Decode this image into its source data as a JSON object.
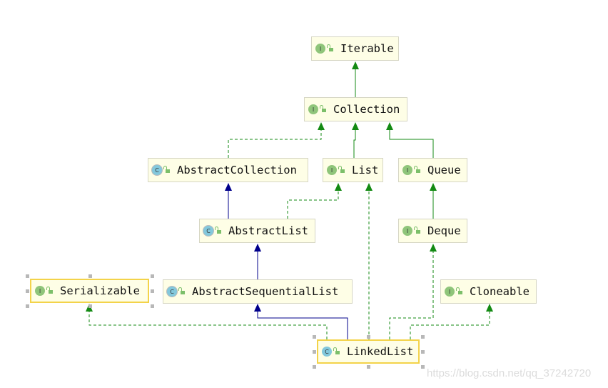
{
  "nodes": [
    {
      "id": "Iterable",
      "label": "Iterable",
      "kind": "interface",
      "badge": "I",
      "selected": false
    },
    {
      "id": "Collection",
      "label": "Collection",
      "kind": "interface",
      "badge": "I",
      "selected": false
    },
    {
      "id": "AbstractCollection",
      "label": "AbstractCollection",
      "kind": "abstract-class",
      "badge": "C",
      "selected": false
    },
    {
      "id": "List",
      "label": "List",
      "kind": "interface",
      "badge": "I",
      "selected": false
    },
    {
      "id": "Queue",
      "label": "Queue",
      "kind": "interface",
      "badge": "I",
      "selected": false
    },
    {
      "id": "AbstractList",
      "label": "AbstractList",
      "kind": "abstract-class",
      "badge": "C",
      "selected": false
    },
    {
      "id": "Deque",
      "label": "Deque",
      "kind": "interface",
      "badge": "I",
      "selected": false
    },
    {
      "id": "Serializable",
      "label": "Serializable",
      "kind": "interface",
      "badge": "I",
      "selected": true
    },
    {
      "id": "AbstractSequentialList",
      "label": "AbstractSequentialList",
      "kind": "abstract-class",
      "badge": "C",
      "selected": false
    },
    {
      "id": "Cloneable",
      "label": "Cloneable",
      "kind": "interface",
      "badge": "I",
      "selected": false
    },
    {
      "id": "LinkedList",
      "label": "LinkedList",
      "kind": "class",
      "badge": "C",
      "selected": true
    }
  ],
  "edges": [
    {
      "from": "Collection",
      "to": "Iterable",
      "type": "extends-interface"
    },
    {
      "from": "List",
      "to": "Collection",
      "type": "extends-interface"
    },
    {
      "from": "Queue",
      "to": "Collection",
      "type": "extends-interface"
    },
    {
      "from": "AbstractCollection",
      "to": "Collection",
      "type": "implements"
    },
    {
      "from": "AbstractList",
      "to": "AbstractCollection",
      "type": "extends-class"
    },
    {
      "from": "AbstractList",
      "to": "List",
      "type": "implements"
    },
    {
      "from": "Deque",
      "to": "Queue",
      "type": "extends-interface"
    },
    {
      "from": "AbstractSequentialList",
      "to": "AbstractList",
      "type": "extends-class"
    },
    {
      "from": "LinkedList",
      "to": "AbstractSequentialList",
      "type": "extends-class"
    },
    {
      "from": "LinkedList",
      "to": "Serializable",
      "type": "implements"
    },
    {
      "from": "LinkedList",
      "to": "List",
      "type": "implements"
    },
    {
      "from": "LinkedList",
      "to": "Deque",
      "type": "implements"
    },
    {
      "from": "LinkedList",
      "to": "Cloneable",
      "type": "implements"
    }
  ],
  "colors": {
    "interface_edge": "#138a13",
    "class_edge": "#00008b",
    "node_bg": "#fefee6",
    "selection": "#f3d34a"
  },
  "watermark": "https://blog.csdn.net/qq_37242720"
}
